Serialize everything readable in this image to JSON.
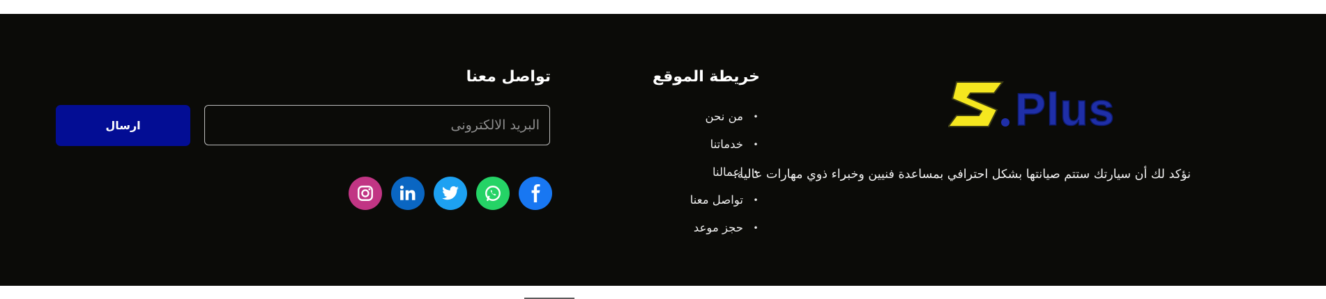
{
  "brand": {
    "logo_text": "S.Plus",
    "tagline": "نؤكد لك أن سيارتك ستتم صيانتها بشكل احترافي بمساعدة فنيين وخبراء ذوي مهارات عالية."
  },
  "sitemap": {
    "title": "خريطة الموقع",
    "items": [
      {
        "label": "من نحن"
      },
      {
        "label": "خدماتنا"
      },
      {
        "label": "اعمالنا"
      },
      {
        "label": "تواصل معنا"
      },
      {
        "label": "حجز موعد"
      }
    ]
  },
  "contact": {
    "title": "تواصل معنا",
    "email_placeholder": "البريد الالكترونى",
    "email_value": "",
    "send_label": "ارسال"
  },
  "socials": [
    {
      "name": "facebook-icon",
      "color": "#1877f2"
    },
    {
      "name": "whatsapp-icon",
      "color": "#25d366"
    },
    {
      "name": "twitter-icon",
      "color": "#1da1f2"
    },
    {
      "name": "linkedin-icon",
      "color": "#0a66c2"
    },
    {
      "name": "instagram-icon",
      "color": "#c13584"
    }
  ],
  "colors": {
    "footer_bg": "#0b0b08",
    "button_bg": "#030d94",
    "logo_yellow": "#f5e71f",
    "logo_blue": "#1f2fa8"
  }
}
